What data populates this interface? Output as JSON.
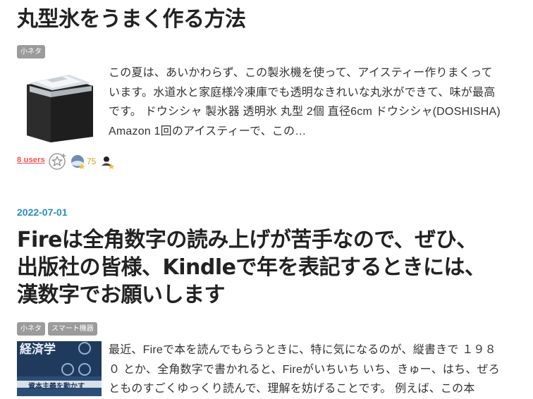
{
  "post1": {
    "title": "丸型氷をうまく作る方法",
    "tags": [
      "小ネタ"
    ],
    "excerpt": "この夏は、あいかわらず、この製氷機を使って、アイスティー作りまくっています。水道水と家庭様冷凍庫でも透明なきれいな丸氷ができて、味が最高です。 ドウシシャ 製氷器 透明氷 丸型 2個 直径6cm ドウシシャ(DOSHISHA) Amazon 1回のアイスティーで、この…",
    "thumbnail_icon": "ice-maker-image",
    "bookmark_users": "8 users",
    "star_count": "75"
  },
  "post2": {
    "date": "2022-07-01",
    "title_lines": [
      "Fireは全角数字の読み上げが苦手なので、ぜひ、",
      "出版社の皆様、Kindleで年を表記するときには、",
      "漢数字でお願いします"
    ],
    "tags": [
      "小ネタ",
      "スマート機器"
    ],
    "excerpt": "最近、Fireで本を読んでもらうときに、特に気になるのが、縦書きで １９８０ とか、全角数字で書かれると、Fireがいちいち いち、きゅー、はち、ぜろ とものすごくゆっくり読んで、理解を妨げることです。 例えば、この本",
    "thumbnail_icon": "book-cover-image",
    "cover_text": [
      "経済学",
      "資本主義を動かす"
    ]
  }
}
